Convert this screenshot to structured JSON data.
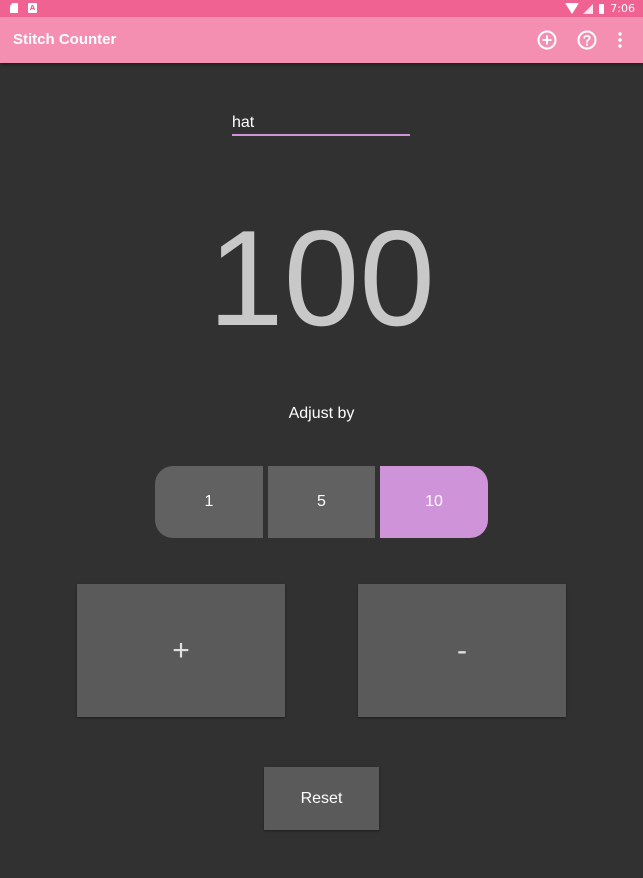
{
  "status_bar": {
    "time": "7:06",
    "left_icons": [
      "sd-card-icon",
      "android-notification-icon"
    ],
    "right_icons": [
      "wifi-icon",
      "signal-icon",
      "battery-icon"
    ],
    "a_glyph": "A",
    "color": "#f06292"
  },
  "app_bar": {
    "title": "Stitch Counter",
    "color": "#f48fb1",
    "actions": [
      "add-circle-icon",
      "help-circle-icon",
      "overflow-menu-icon"
    ]
  },
  "project": {
    "name": "hat"
  },
  "counter": {
    "value": "100"
  },
  "adjust": {
    "label": "Adjust by",
    "options": [
      "1",
      "5",
      "10"
    ],
    "selected": "10",
    "selected_color": "#ce93d8"
  },
  "buttons": {
    "increment": "+",
    "decrement": "-",
    "reset": "Reset"
  }
}
